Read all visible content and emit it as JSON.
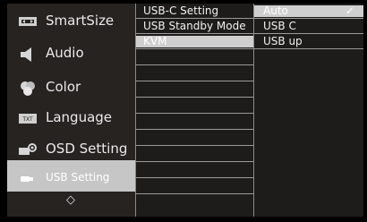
{
  "menu": {
    "items": [
      {
        "label": "SmartSize",
        "icon": "smartsize-icon"
      },
      {
        "label": "Audio",
        "icon": "speaker-icon"
      },
      {
        "label": "Color",
        "icon": "color-palette-icon"
      },
      {
        "label": "Language",
        "icon": "language-icon"
      },
      {
        "label": "OSD Setting",
        "icon": "osd-setting-icon"
      },
      {
        "label": "USB Setting",
        "icon": "usb-icon"
      }
    ],
    "nav_symbol": "◇"
  },
  "submenu": {
    "items": [
      "USB-C Setting",
      "USB Standby Mode",
      "KVM"
    ]
  },
  "options": {
    "items": [
      "Auto",
      "USB C",
      "USB up"
    ],
    "check": "✓"
  },
  "colors": {
    "highlight": "#cfcfcf",
    "background": "#1c1c1c",
    "divider": "#9a9a9a"
  }
}
